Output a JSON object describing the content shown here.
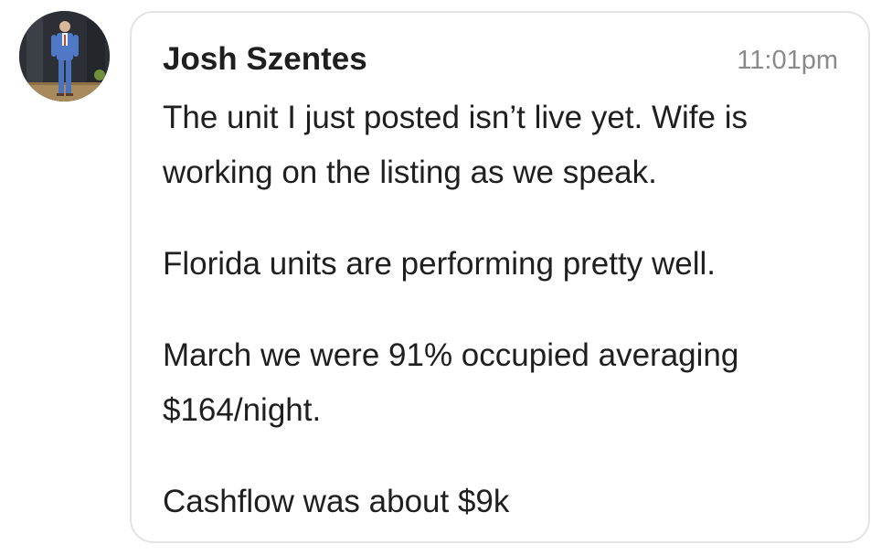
{
  "message": {
    "author": "Josh Szentes",
    "time": "11:01pm",
    "paragraphs": [
      "The unit I just posted isn’t live yet. Wife is working on the listing as we speak.",
      "Florida units are performing pretty well.",
      "March we were 91% occupied averaging $164/night.",
      "Cashflow was about $9k"
    ]
  },
  "avatar": {
    "icon": "user-profile-photo"
  }
}
